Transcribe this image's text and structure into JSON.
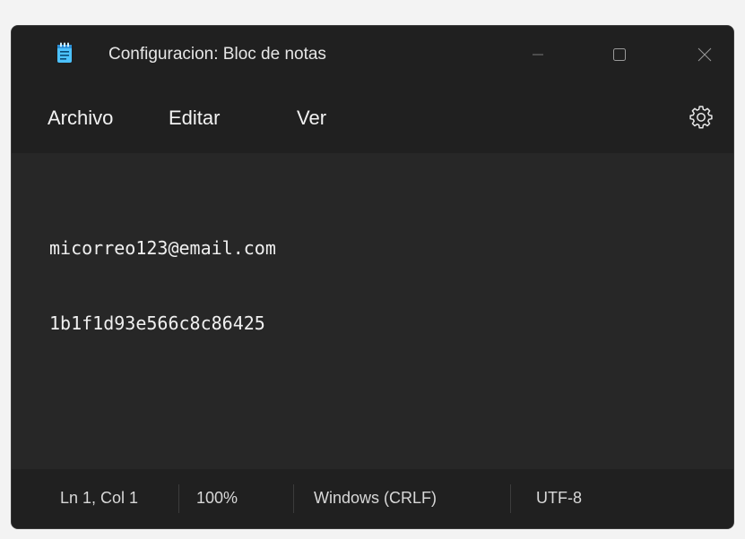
{
  "window": {
    "title": "Configuracion: Bloc de notas",
    "app_icon": "notepad-icon",
    "controls": {
      "minimize_icon": "minimize-icon",
      "maximize_icon": "maximize-icon",
      "close_icon": "close-icon"
    }
  },
  "menu": {
    "items": [
      {
        "label": "Archivo"
      },
      {
        "label": "Editar"
      },
      {
        "label": "Ver"
      }
    ],
    "settings_icon": "gear-icon"
  },
  "editor": {
    "lines": [
      "micorreo123@email.com",
      "1b1f1d93e566c8c86425"
    ]
  },
  "status": {
    "position": "Ln 1, Col 1",
    "zoom": "100%",
    "line_ending": "Windows (CRLF)",
    "encoding": "UTF-8"
  },
  "colors": {
    "background": "#202020",
    "editor_background": "#272727",
    "text": "#f0f0f0",
    "icon_accent": "#4cc2ff"
  }
}
